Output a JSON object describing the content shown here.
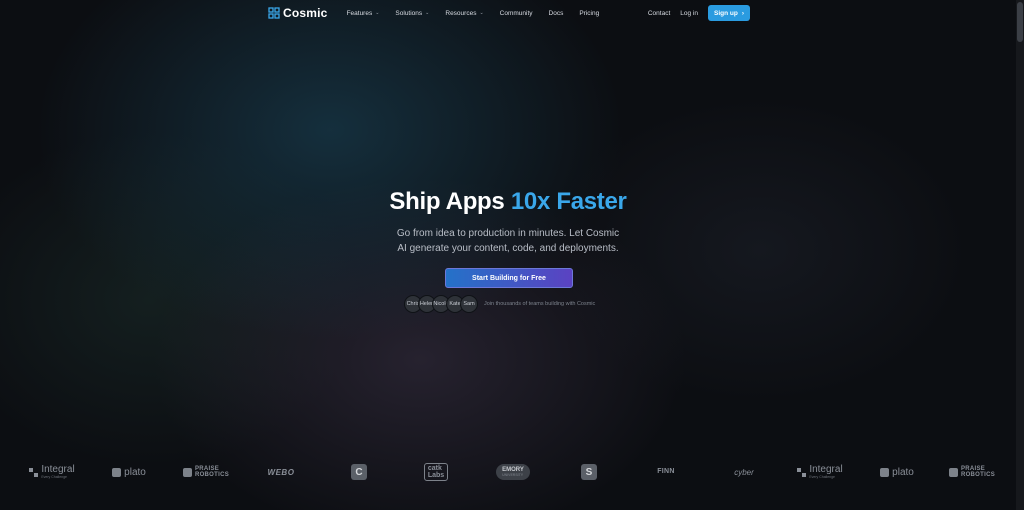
{
  "nav": {
    "brand": "Cosmic",
    "links": [
      {
        "label": "Features"
      },
      {
        "label": "Solutions"
      },
      {
        "label": "Resources"
      },
      {
        "label": "Community"
      },
      {
        "label": "Docs"
      },
      {
        "label": "Pricing"
      }
    ],
    "contact": "Contact",
    "login": "Log in",
    "signup": "Sign up",
    "chevron": "⌄",
    "signup_arrow": "›"
  },
  "hero": {
    "title_main": "Ship Apps ",
    "title_accent": "10x Faster",
    "subtitle_line1": "Go from idea to production in minutes. Let Cosmic",
    "subtitle_line2": "AI generate your content, code, and deployments.",
    "cta": "Start Building for Free",
    "social_proof": "Join thousands of teams building with Cosmic",
    "avatars": [
      "Chris",
      "Helen",
      "Nicole",
      "Kate",
      "Sam"
    ]
  },
  "logos": {
    "integral": "Integral",
    "integral_tag": "Every Challenge",
    "plato": "plato",
    "praise_line1": "PRAISE",
    "praise_line2": "ROBOTICS",
    "weebo": "WEBO",
    "c_mark": "C",
    "mark_top": "catk",
    "mark_bottom": "Labs",
    "emory": "EMORY",
    "emory_tag": "UNIVERSITY",
    "finn": "FINN",
    "cyber": "cyber",
    "s_mark": "S"
  },
  "colors": {
    "accent": "#3aa7ea",
    "signup": "#2a9be0",
    "cta_start": "#2472c8",
    "cta_end": "#5b42c2",
    "background": "#0c0e12"
  }
}
